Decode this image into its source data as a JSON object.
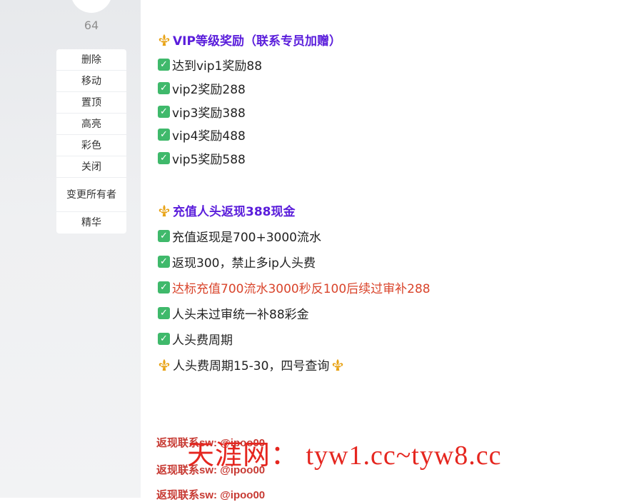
{
  "sidebar": {
    "post_count": "64",
    "menu": [
      "删除",
      "移动",
      "置顶",
      "高亮",
      "彩色",
      "关闭",
      "变更所有者",
      "精华"
    ]
  },
  "post": {
    "vip_heading": "VIP等级奖励（联系专员加赠）",
    "vip_items": [
      "达到vip1奖励88",
      "vip2奖励288",
      "vip3奖励388",
      "vip4奖励488",
      "vip5奖励588"
    ],
    "refund_heading": "充值人头返现388现金",
    "refund_items": [
      "充值返现是700+3000流水",
      "返现300，禁止多ip人头费",
      "达标充值700流水3000秒反100后续过审补288",
      "人头未过审统一补88彩金",
      "人头费周期"
    ],
    "cycle_note": "人头费周期15-30，四号查询",
    "contacts": [
      "返现联系sw: @ipoo00",
      "返现联系sw: @ipoo00",
      "返现联系sw: @ipoo00"
    ]
  },
  "watermark": {
    "text": "天涯网： tyw1.cc~tyw8.cc"
  },
  "colors": {
    "heading": "#5a1ddb",
    "check": "#3fb96b",
    "highlight": "#d9442b",
    "watermark": "#e5261f",
    "fleur": "#e8a317"
  },
  "icons": {
    "check": "check-mark-icon",
    "fleur": "fleur-de-lis-icon"
  }
}
